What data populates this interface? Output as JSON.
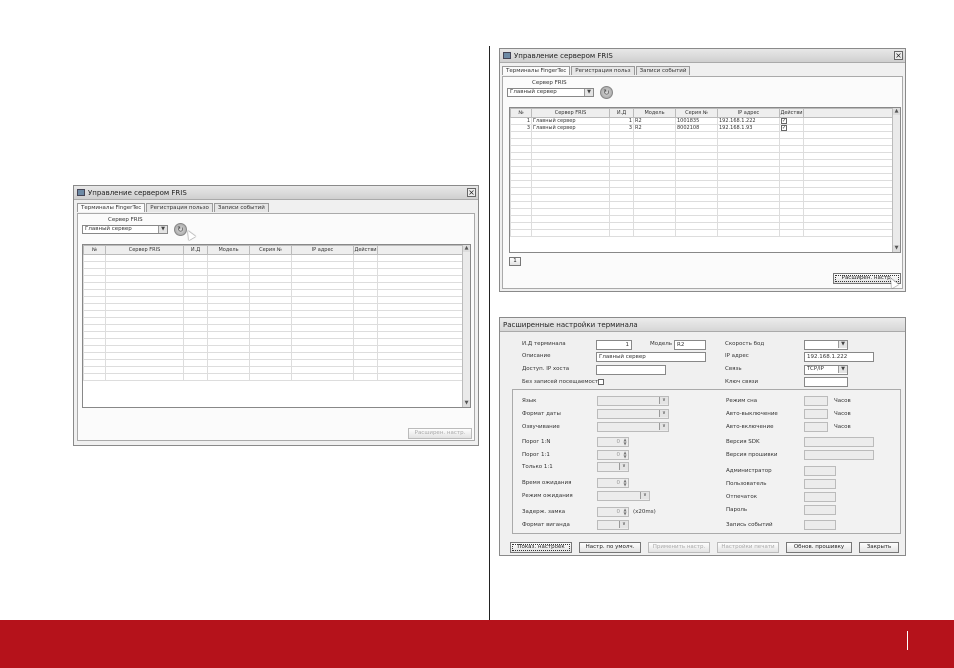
{
  "colors": {
    "footer": "#b5121b",
    "window_bg": "#f0f0f0",
    "grid_bg": "#ffffff"
  },
  "win_small": {
    "title": "Управление сервером FRIS",
    "tabs": [
      "Терминалы FingerTec",
      "Регистрация пользо",
      "Записи событий"
    ],
    "server_label": "Сервер FRIS",
    "server_value": "Главный сервер",
    "columns": [
      "№",
      "Сервер FRIS",
      "И.Д",
      "Модель",
      "Серия №",
      "IP адрес",
      "Действи"
    ],
    "advanced_button": "Расширен. настр."
  },
  "win_big": {
    "title": "Управление сервером FRIS",
    "tabs": [
      "Терминалы FingerTec",
      "Регистрация польз",
      "Записи событий"
    ],
    "server_label": "Сервер FRIS",
    "server_value": "Главный сервер",
    "columns": [
      "№",
      "Сервер FRIS",
      "И.Д",
      "Модель",
      "Серия №",
      "IP адрес",
      "Действи"
    ],
    "rows": [
      {
        "no": "1",
        "server": "Главный сервер",
        "id": "1",
        "model": "R2",
        "serial": "1001835",
        "ip": "192.168.1.222",
        "check": "✓"
      },
      {
        "no": "3",
        "server": "Главный сервер",
        "id": "3",
        "model": "R2",
        "serial": "8002108",
        "ip": "192.168.1.93",
        "check": "✓"
      }
    ],
    "page": "1",
    "advanced_button": "Расширен. настр."
  },
  "adv": {
    "title": "Расширенные настройки терминала",
    "terminal_id_label": "И.Д терминала",
    "terminal_id_value": "1",
    "model_label": "Модель",
    "model_value": "R2",
    "baud_label": "Скорость бод",
    "description_label": "Описание",
    "description_value": "Главный сервер",
    "ip_label": "IP адрес",
    "ip_value": "192.168.1.222",
    "host_ip_label": "Доступ. IP хоста",
    "link_label": "Связь",
    "link_value": "TCP/IP",
    "no_log_label": "Без записей посещаемости",
    "key_label": "Ключ связи",
    "lang_label": "Язык",
    "date_format_label": "Формат даты",
    "sound_label": "Озвучивание",
    "threshold_1n_label": "Порог 1:N",
    "threshold_1n_value": "0",
    "threshold_11_label": "Порог 1:1",
    "threshold_11_value": "0",
    "only_11_label": "Только 1:1",
    "wait_time_label": "Время ожидания",
    "wait_time_value": "0",
    "wait_mode_label": "Режим ожидания",
    "lock_delay_label": "Задерж. замка",
    "lock_delay_value": "0",
    "lock_delay_unit": "(x20ms)",
    "wiegand_label": "Формат виганда",
    "sleep_mode_label": "Режим сна",
    "auto_off_label": "Авто-выключение",
    "auto_on_label": "Авто-включение",
    "hours_unit": "Часов",
    "sdk_label": "Версия SDK",
    "firmware_label": "Версия прошивки",
    "admin_label": "Администратор",
    "user_label": "Пользователь",
    "fingerprint_label": "Отпечаток",
    "password_label": "Пароль",
    "event_log_label": "Запись событий",
    "buttons": [
      "Показ. настроек",
      "Настр. по умолч.",
      "Применить настр.",
      "Настройки печати",
      "Обнов. прошивку",
      "Закрыть"
    ]
  }
}
